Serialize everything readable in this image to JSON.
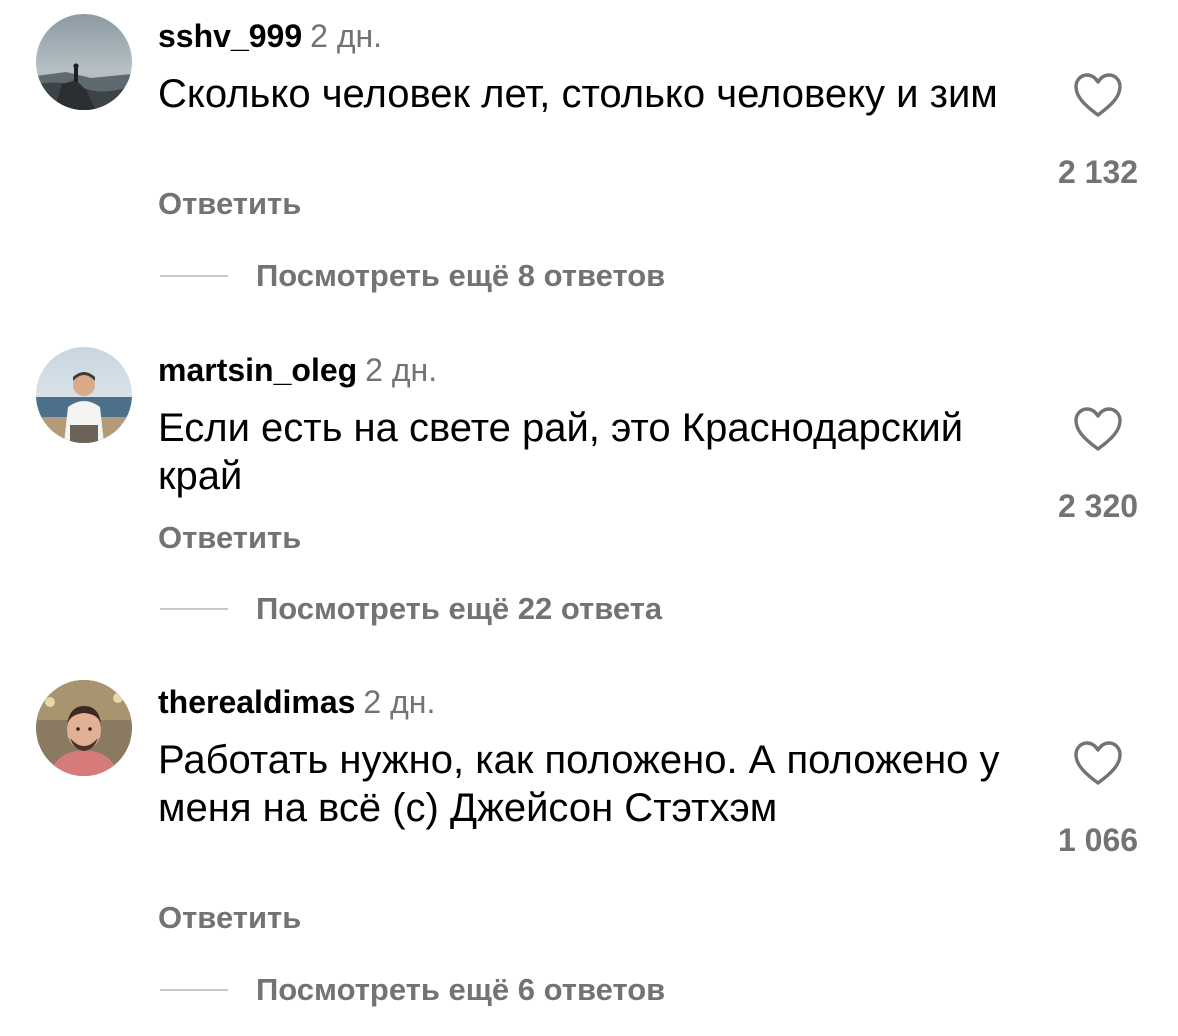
{
  "comments": [
    {
      "username": "sshv_999",
      "time": "2 дн.",
      "text": "Сколько человек лет, столько человеку и зим",
      "reply_label": "Ответить",
      "more_replies": "Посмотреть ещё 8 ответов",
      "likes": "2 132",
      "avatar_icon": "landscape-avatar"
    },
    {
      "username": "martsin_oleg",
      "time": "2 дн.",
      "text": "Если есть на свете рай, это Краснодарский край",
      "reply_label": "Ответить",
      "more_replies": "Посмотреть ещё 22 ответа",
      "likes": "2 320",
      "avatar_icon": "person-sea-avatar"
    },
    {
      "username": "therealdimas",
      "time": "2 дн.",
      "text": "Работать нужно, как положено. А положено у меня на всё (с) Джейсон Стэтхэм",
      "reply_label": "Ответить",
      "more_replies": "Посмотреть ещё 6 ответов",
      "likes": "1 066",
      "avatar_icon": "portrait-avatar"
    }
  ],
  "colors": {
    "text": "#000000",
    "secondary": "#737373",
    "divider": "#c7c7c7"
  }
}
